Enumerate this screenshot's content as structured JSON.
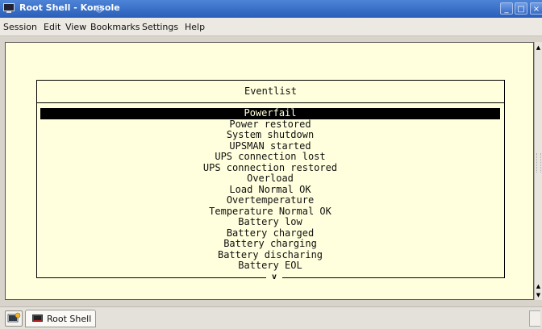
{
  "window": {
    "title": "Root Shell - Konsole"
  },
  "menu": [
    "Session",
    "Edit",
    "View",
    "Bookmarks",
    "Settings",
    "Help"
  ],
  "dialog": {
    "title": "Eventlist",
    "items": [
      "Powerfail",
      "Power restored",
      "System shutdown",
      "UPSMAN started",
      "UPS connection lost",
      "UPS connection restored",
      "Overload",
      "Load Normal OK",
      "Overtemperature",
      "Temperature Normal OK",
      "Battery low",
      "Battery charged",
      "Battery charging",
      "Battery discharing",
      "Battery EOL"
    ],
    "selected_index": 0,
    "more_indicator": "v"
  },
  "taskbar": {
    "tab_label": "Root Shell"
  },
  "colors": {
    "terminal_bg": "#ffffdd",
    "titlebar": "#3a6bc4",
    "selection": "#000000"
  }
}
